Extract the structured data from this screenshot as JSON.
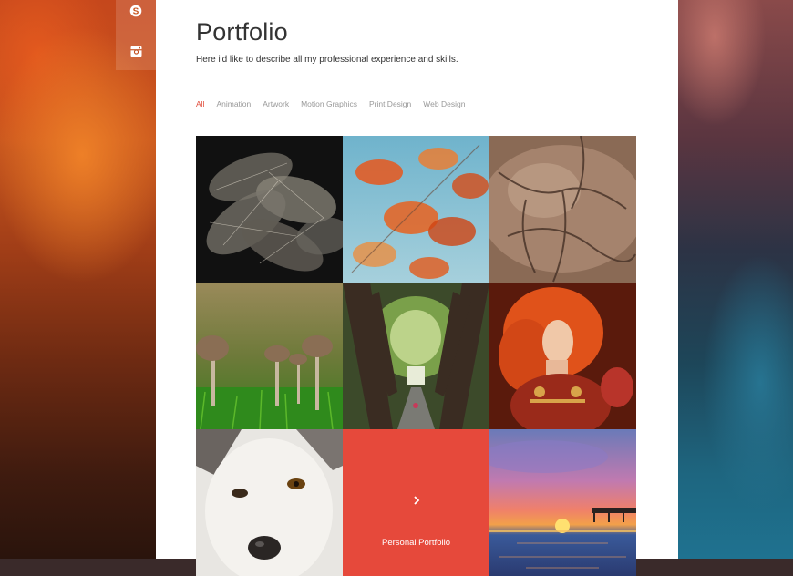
{
  "social": {
    "icons": [
      "skype-icon",
      "instagram-icon"
    ]
  },
  "page": {
    "title": "Portfolio",
    "subtitle": "Here i'd like to describe all my professional experience and skills."
  },
  "filters": [
    {
      "label": "All",
      "active": true
    },
    {
      "label": "Animation",
      "active": false
    },
    {
      "label": "Artwork",
      "active": false
    },
    {
      "label": "Motion Graphics",
      "active": false
    },
    {
      "label": "Print Design",
      "active": false
    },
    {
      "label": "Web Design",
      "active": false
    }
  ],
  "gallery": {
    "items": [
      {
        "subject": "skeleton leaves"
      },
      {
        "subject": "orange autumn leaves"
      },
      {
        "subject": "tree bark"
      },
      {
        "subject": "mushrooms"
      },
      {
        "subject": "tree tunnel road"
      },
      {
        "subject": "red-haired woman"
      },
      {
        "subject": "husky dog"
      },
      {
        "hover_label": "Personal Portfolio",
        "icon": "chevron-right-icon"
      },
      {
        "subject": "sunset beach"
      }
    ]
  },
  "colors": {
    "accent": "#e6493b",
    "filter_active": "#e04b3a",
    "filter_inactive": "#999999",
    "text": "#333333"
  }
}
